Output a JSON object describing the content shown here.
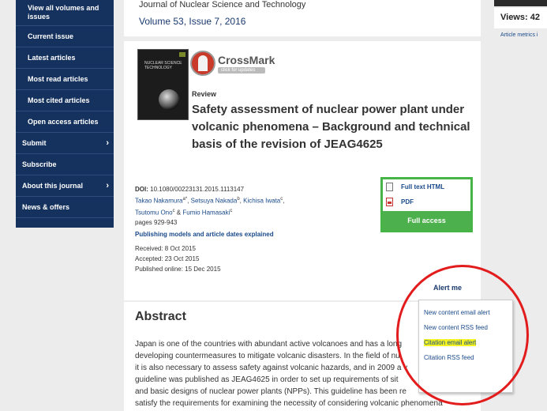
{
  "sidebar": {
    "items": [
      {
        "label": "View all volumes and issues",
        "chevron": false,
        "indent": "sub"
      },
      {
        "label": "Current issue",
        "chevron": false,
        "indent": "sub"
      },
      {
        "label": "Latest articles",
        "chevron": false,
        "indent": "sub"
      },
      {
        "label": "Most read articles",
        "chevron": false,
        "indent": "sub"
      },
      {
        "label": "Most cited articles",
        "chevron": false,
        "indent": "sub"
      },
      {
        "label": "Open access articles",
        "chevron": false,
        "indent": "sub"
      },
      {
        "label": "Submit",
        "chevron": true,
        "indent": "top"
      },
      {
        "label": "Subscribe",
        "chevron": false,
        "indent": "top"
      },
      {
        "label": "About this journal",
        "chevron": true,
        "indent": "top"
      },
      {
        "label": "News & offers",
        "chevron": false,
        "indent": "top"
      }
    ]
  },
  "journal": {
    "title": "Journal of Nuclear Science and Technology",
    "volume": "Volume 53, Issue 7, 2016"
  },
  "cover": {
    "text": "NUCLEAR SCIENCE TECHNOLOGY"
  },
  "crossmark": {
    "title": "CrossMark",
    "subtitle": "click for updates"
  },
  "article": {
    "type": "Review",
    "title": "Safety assessment of nuclear power plant under volcanic phenomena – Background and technical basis of the revision of JEAG4625",
    "doi_label": "DOI:",
    "doi": "10.1080/00223131.2015.1113147",
    "authors": [
      {
        "name": "Takao Nakamura",
        "sup": "a*"
      },
      {
        "name": "Setsuya Nakada",
        "sup": "b"
      },
      {
        "name": "Kichisa Iwata",
        "sup": "c"
      },
      {
        "name": "Tsutomu Ono",
        "sup": "c"
      },
      {
        "name": "Fumio Hamasaki",
        "sup": "c"
      }
    ],
    "pages": "pages 929-943",
    "publishing_models": "Publishing models and article dates explained",
    "received": "Received: 8 Oct 2015",
    "accepted": "Accepted: 23 Oct 2015",
    "published": "Published online: 15 Dec 2015"
  },
  "access": {
    "full_text": "Full text HTML",
    "pdf": "PDF",
    "full_access": "Full access"
  },
  "alert": {
    "label": "Alert me",
    "items": [
      {
        "label": "New content email alert",
        "highlight": false
      },
      {
        "label": "New content RSS feed",
        "highlight": false
      },
      {
        "label": "Citation email alert",
        "highlight": true
      },
      {
        "label": "Citation RSS feed",
        "highlight": false
      }
    ]
  },
  "abstract": {
    "heading": "Abstract",
    "lines": [
      "Japan is one of the countries with abundant active volcanoes and has a long",
      "developing countermeasures to mitigate volcanic disasters. In the field of nu",
      "it is also necessary to assess safety against volcanic hazards, and in 2009 a v",
      "guideline was published as JEAG4625 in order to set up requirements of sit",
      "and basic designs of nuclear power plants (NPPs). This guideline has been re",
      "satisfy the requirements for examining the necessity of considering volcanic phenomena"
    ]
  },
  "right": {
    "views_label": "Views: 42",
    "metrics_link": "Article metrics i"
  },
  "colors": {
    "sidebar_bg": "#15325e",
    "access_border": "#47b447",
    "highlight": "#f3f321",
    "annotation_ring": "#e21c1c"
  }
}
